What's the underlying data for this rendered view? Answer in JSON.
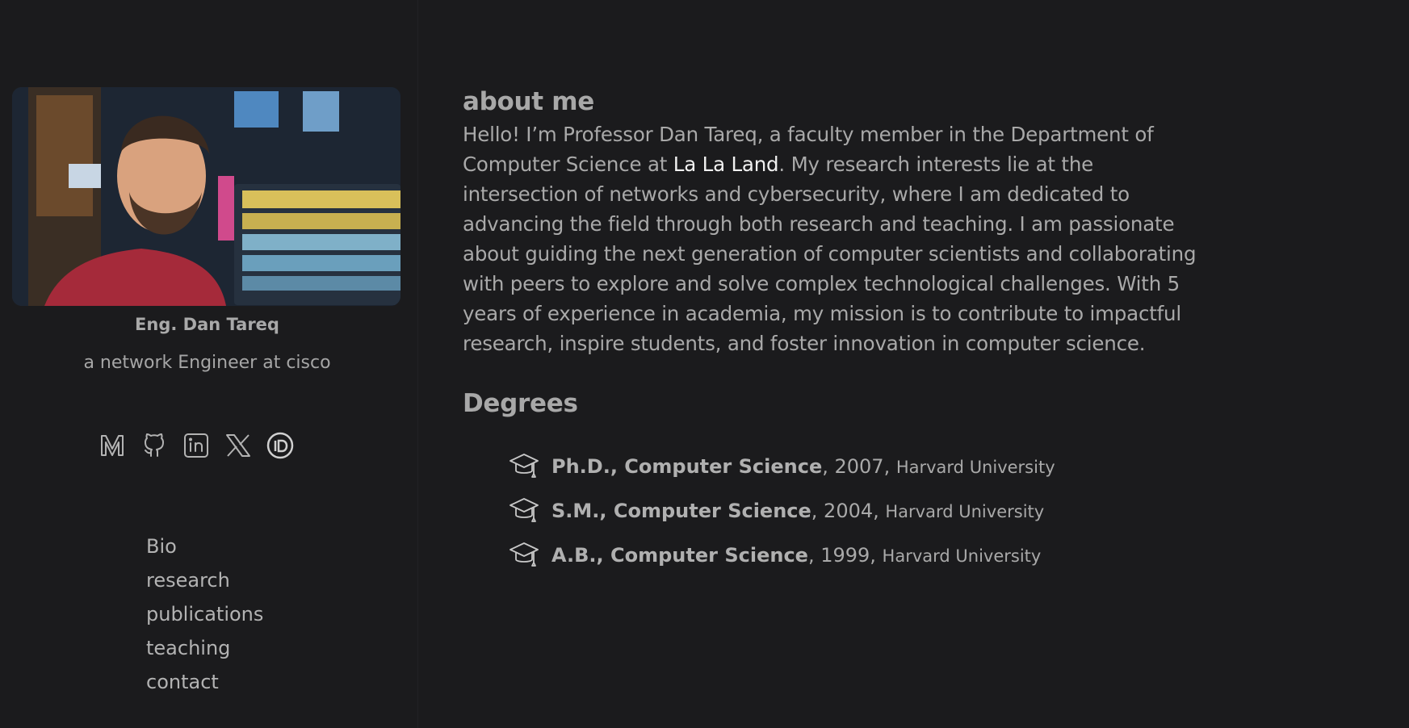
{
  "profile": {
    "name": "Eng. Dan Tareq",
    "role": "a network Engineer at cisco",
    "photo_alt": "profile photo"
  },
  "socials": [
    {
      "name": "medium",
      "icon": "medium-icon"
    },
    {
      "name": "github",
      "icon": "github-icon"
    },
    {
      "name": "linkedin",
      "icon": "linkedin-icon"
    },
    {
      "name": "x",
      "icon": "x-icon"
    },
    {
      "name": "orcid",
      "icon": "orcid-icon"
    }
  ],
  "nav": {
    "bio": "Bio",
    "research": "research",
    "publications": "publications",
    "teaching": "teaching",
    "contact": "contact"
  },
  "about": {
    "title": "about me",
    "text_before": "Hello! I’m Professor Dan Tareq, a faculty member in the Department of Computer Science at ",
    "link": "La La Land",
    "text_after": ". My research interests lie at the intersection of networks and cybersecurity, where I am dedicated to advancing the field through both research and teaching. I am passionate about guiding the next generation of computer scientists and collaborating with peers to explore and solve complex technological challenges. With 5 years of experience in academia, my mission is to contribute to impactful research, inspire students, and foster innovation in computer science."
  },
  "degrees": {
    "title": "Degrees",
    "items": [
      {
        "degree": "Ph.D., Computer Science",
        "year": ", 2007, ",
        "school": "Harvard University"
      },
      {
        "degree": "S.M., Computer Science",
        "year": ", 2004, ",
        "school": "Harvard University"
      },
      {
        "degree": "A.B., Computer Science",
        "year": ", 1999, ",
        "school": "Harvard University"
      }
    ]
  },
  "colors": {
    "background": "#1b1b1d",
    "text": "#a9a9a9",
    "link": "#f1f1f1"
  }
}
